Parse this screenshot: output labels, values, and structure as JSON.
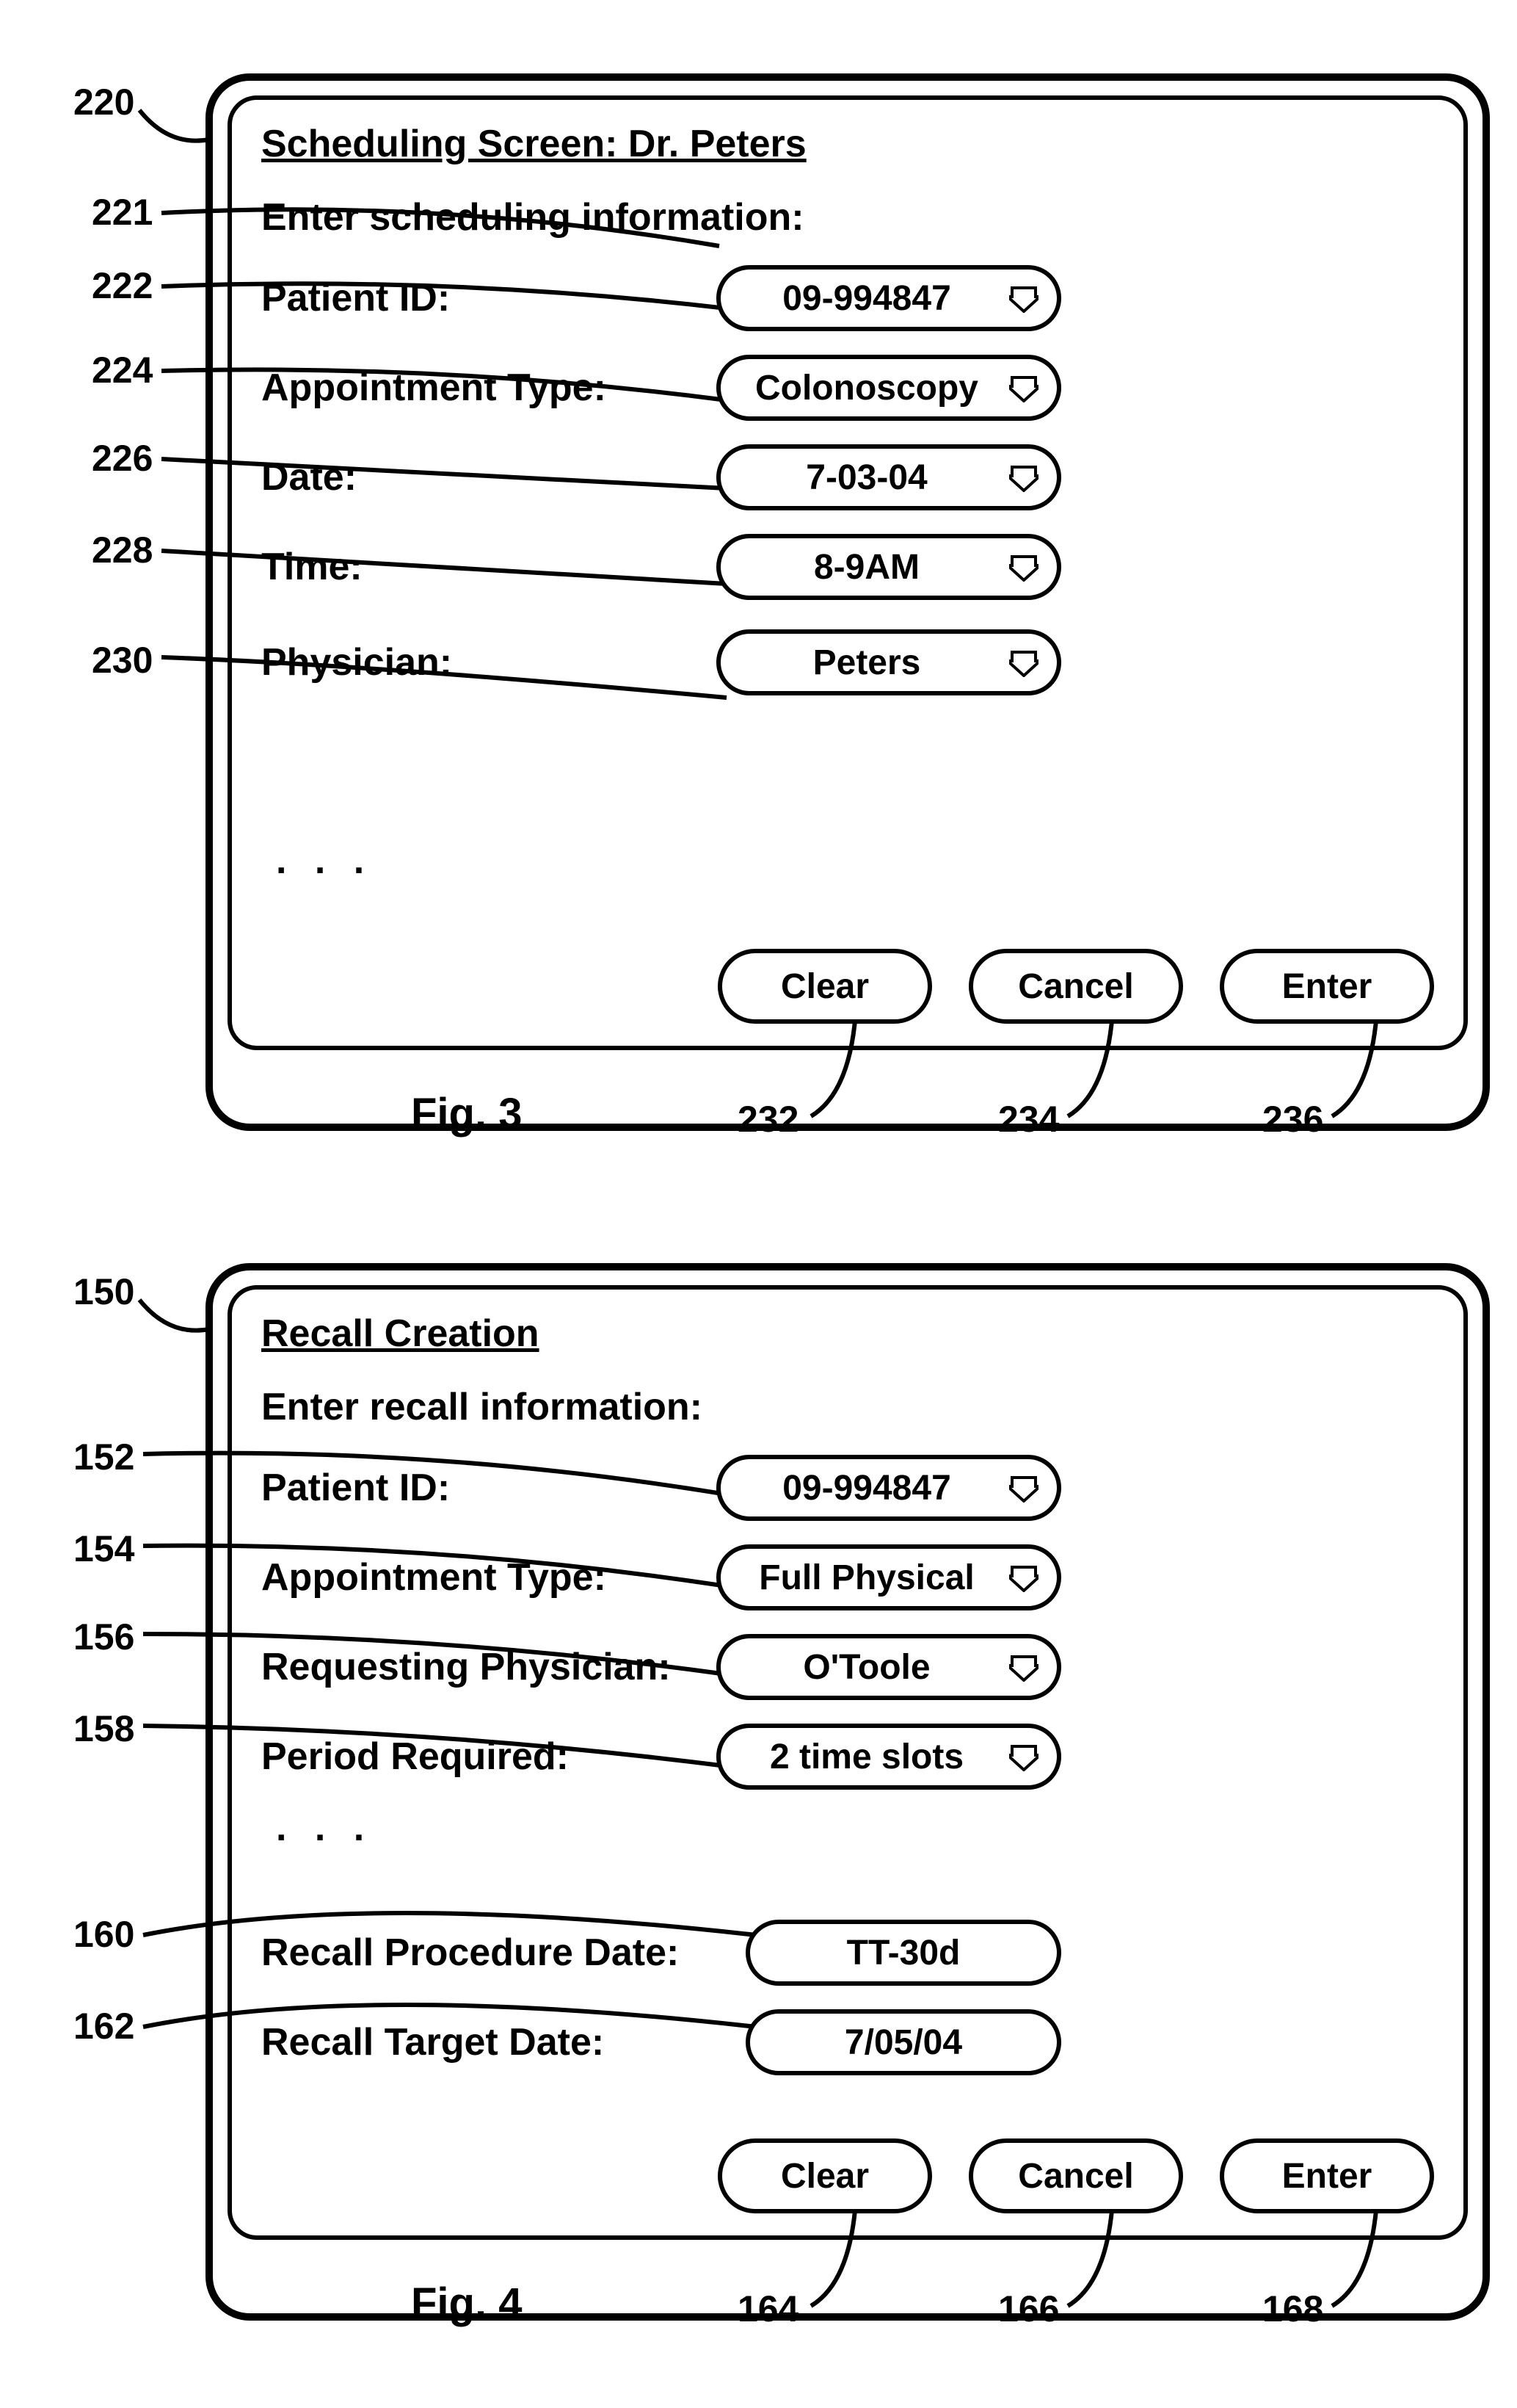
{
  "fig3": {
    "caption": "Fig. 3",
    "title": "Scheduling Screen: Dr. Peters",
    "prompt": "Enter scheduling information:",
    "rows": {
      "patient": {
        "label": "Patient ID:",
        "value": "09-994847"
      },
      "appt": {
        "label": "Appointment Type:",
        "value": "Colonoscopy"
      },
      "date": {
        "label": "Date:",
        "value": "7-03-04"
      },
      "time": {
        "label": "Time:",
        "value": "8-9AM"
      },
      "physician": {
        "label": "Physician:",
        "value": "Peters"
      }
    },
    "ellipsis": ". . .",
    "buttons": {
      "clear": "Clear",
      "cancel": "Cancel",
      "enter": "Enter"
    },
    "refs": {
      "panel": "220",
      "prompt": "221",
      "patient": "222",
      "appt": "224",
      "date": "226",
      "time": "228",
      "physician": "230",
      "clear": "232",
      "cancel": "234",
      "enter": "236"
    }
  },
  "fig4": {
    "caption": "Fig. 4",
    "title": "Recall Creation",
    "prompt": "Enter recall information:",
    "rows": {
      "patient": {
        "label": "Patient ID:",
        "value": "09-994847"
      },
      "appt": {
        "label": "Appointment Type:",
        "value": "Full Physical"
      },
      "reqphys": {
        "label": "Requesting Physician:",
        "value": "O'Toole"
      },
      "period": {
        "label": "Period Required:",
        "value": "2 time slots"
      },
      "procdate": {
        "label": "Recall Procedure Date:",
        "value": "TT-30d"
      },
      "target": {
        "label": "Recall Target Date:",
        "value": "7/05/04"
      }
    },
    "ellipsis": ". . .",
    "buttons": {
      "clear": "Clear",
      "cancel": "Cancel",
      "enter": "Enter"
    },
    "refs": {
      "panel": "150",
      "patient": "152",
      "appt": "154",
      "reqphys": "156",
      "period": "158",
      "procdate": "160",
      "target": "162",
      "clear": "164",
      "cancel": "166",
      "enter": "168"
    }
  }
}
